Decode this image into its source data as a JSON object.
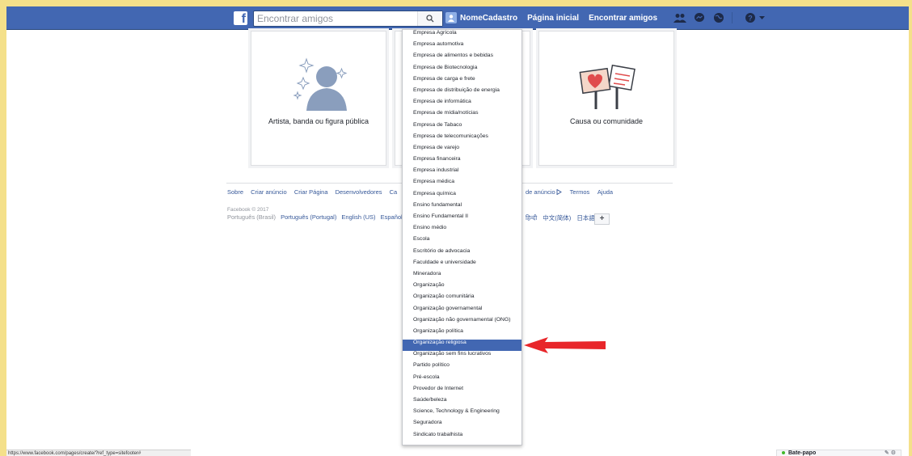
{
  "header": {
    "search_placeholder": "Encontrar amigos",
    "username": "NomeCadastro",
    "home_label": "Página inicial",
    "find_friends_label": "Encontrar amigos"
  },
  "cards": [
    {
      "label": "Artista, banda ou figura pública"
    },
    {
      "label": "Causa ou comunidade"
    }
  ],
  "footer": {
    "links_left": [
      "Sobre",
      "Criar anúncio",
      "Criar Página",
      "Desenvolvedores",
      "Ca"
    ],
    "links_right": [
      "de anúncio",
      "Termos",
      "Ajuda"
    ],
    "adchoices_icon": "adchoices-icon",
    "copyright": "Facebook © 2017",
    "lang_current": "Português (Brasil)",
    "langs_left": [
      "Português (Portugal)",
      "English (US)",
      "Español"
    ],
    "langs_right": [
      "हिन्दी",
      "中文(简体)",
      "日本語"
    ],
    "more_lang_label": "+"
  },
  "dropdown": {
    "items": [
      "Empresa Agrícola",
      "Empresa automotiva",
      "Empresa de alimentos e bebidas",
      "Empresa de Biotecnologia",
      "Empresa de carga e frete",
      "Empresa de distribuição de energia",
      "Empresa de informática",
      "Empresa de mídia/notícias",
      "Empresa de Tabaco",
      "Empresa de telecomunicações",
      "Empresa de varejo",
      "Empresa financeira",
      "Empresa industrial",
      "Empresa médica",
      "Empresa química",
      "Ensino fundamental",
      "Ensino Fundamental II",
      "Ensino médio",
      "Escola",
      "Escritório de advocacia",
      "Faculdade e universidade",
      "Mineradora",
      "Organização",
      "Organização comunitária",
      "Organização governamental",
      "Organização não governamental (ONG)",
      "Organização política",
      "Organização religiosa",
      "Organização sem fins lucrativos",
      "Partido político",
      "Pré-escola",
      "Provedor de Internet",
      "Saúde/beleza",
      "Science, Technology & Engineering",
      "Seguradora",
      "Sindicato trabalhista"
    ],
    "selected": "Organização religiosa"
  },
  "status_bar": {
    "url": "https://www.facebook.com/pages/create/?ref_type=sitefooter#"
  },
  "chat": {
    "label": "Bate-papo"
  },
  "colors": {
    "brand": "#4267b2",
    "arrow": "#e8262a",
    "frame": "#f4e08a"
  }
}
